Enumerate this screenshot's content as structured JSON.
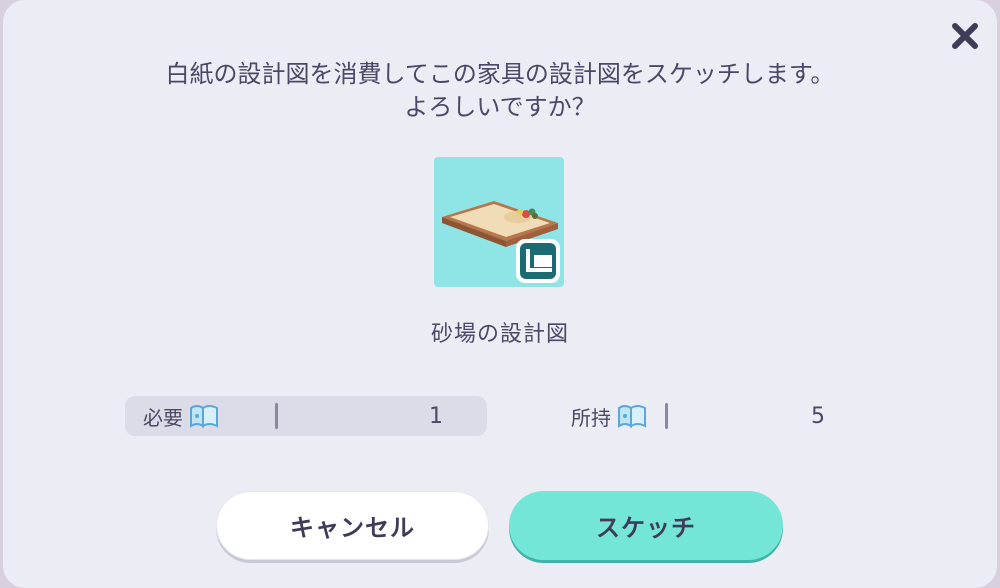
{
  "dialog": {
    "message_line1": "白紙の設計図を消費してこの家具の設計図をスケッチします。",
    "message_line2": "よろしいですか？",
    "close_icon": "close-icon"
  },
  "item": {
    "name": "砂場の設計図",
    "thumbnail_icon": "sandbox-blueprint-icon",
    "background_color": "#8fe5e6"
  },
  "stats": {
    "required_label": "必要",
    "required_value": "1",
    "owned_label": "所持",
    "owned_value": "5",
    "blank_blueprint_icon": "blank-blueprint-icon"
  },
  "buttons": {
    "cancel_label": "キャンセル",
    "confirm_label": "スケッチ"
  },
  "colors": {
    "text": "#4a4866",
    "accent": "#73e6d8",
    "panel": "#ececf4"
  }
}
